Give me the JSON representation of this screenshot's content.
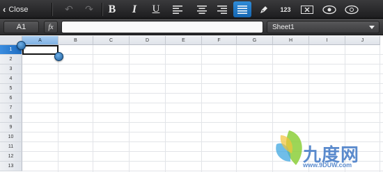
{
  "toolbar": {
    "close_label": "Close",
    "icons": [
      "undo-icon",
      "redo-icon",
      "bold-icon",
      "italic-icon",
      "underline-icon",
      "align-left-icon",
      "align-center-icon",
      "align-right-icon",
      "align-justify-icon",
      "pen-icon",
      "number-format-icon",
      "clear-icon",
      "view-icon-1",
      "view-icon-2"
    ],
    "bold_label": "B",
    "italic_label": "I",
    "underline_label": "U",
    "number_label": "123"
  },
  "formula_bar": {
    "cell_reference": "A1",
    "fx_label": "fx",
    "formula_value": "",
    "sheet_name": "Sheet1"
  },
  "grid": {
    "columns": [
      "A",
      "B",
      "C",
      "D",
      "E",
      "F",
      "G",
      "H",
      "I",
      "J"
    ],
    "rows": [
      "1",
      "2",
      "3",
      "4",
      "5",
      "6",
      "7",
      "8",
      "9",
      "10",
      "11",
      "12",
      "13"
    ],
    "selected_cell": "A1"
  },
  "watermark": {
    "brand": "九度网",
    "url": "www.9DUW.com"
  },
  "colors": {
    "accent": "#1e6cc0",
    "toolbar_bg": "#2a2a2c"
  }
}
